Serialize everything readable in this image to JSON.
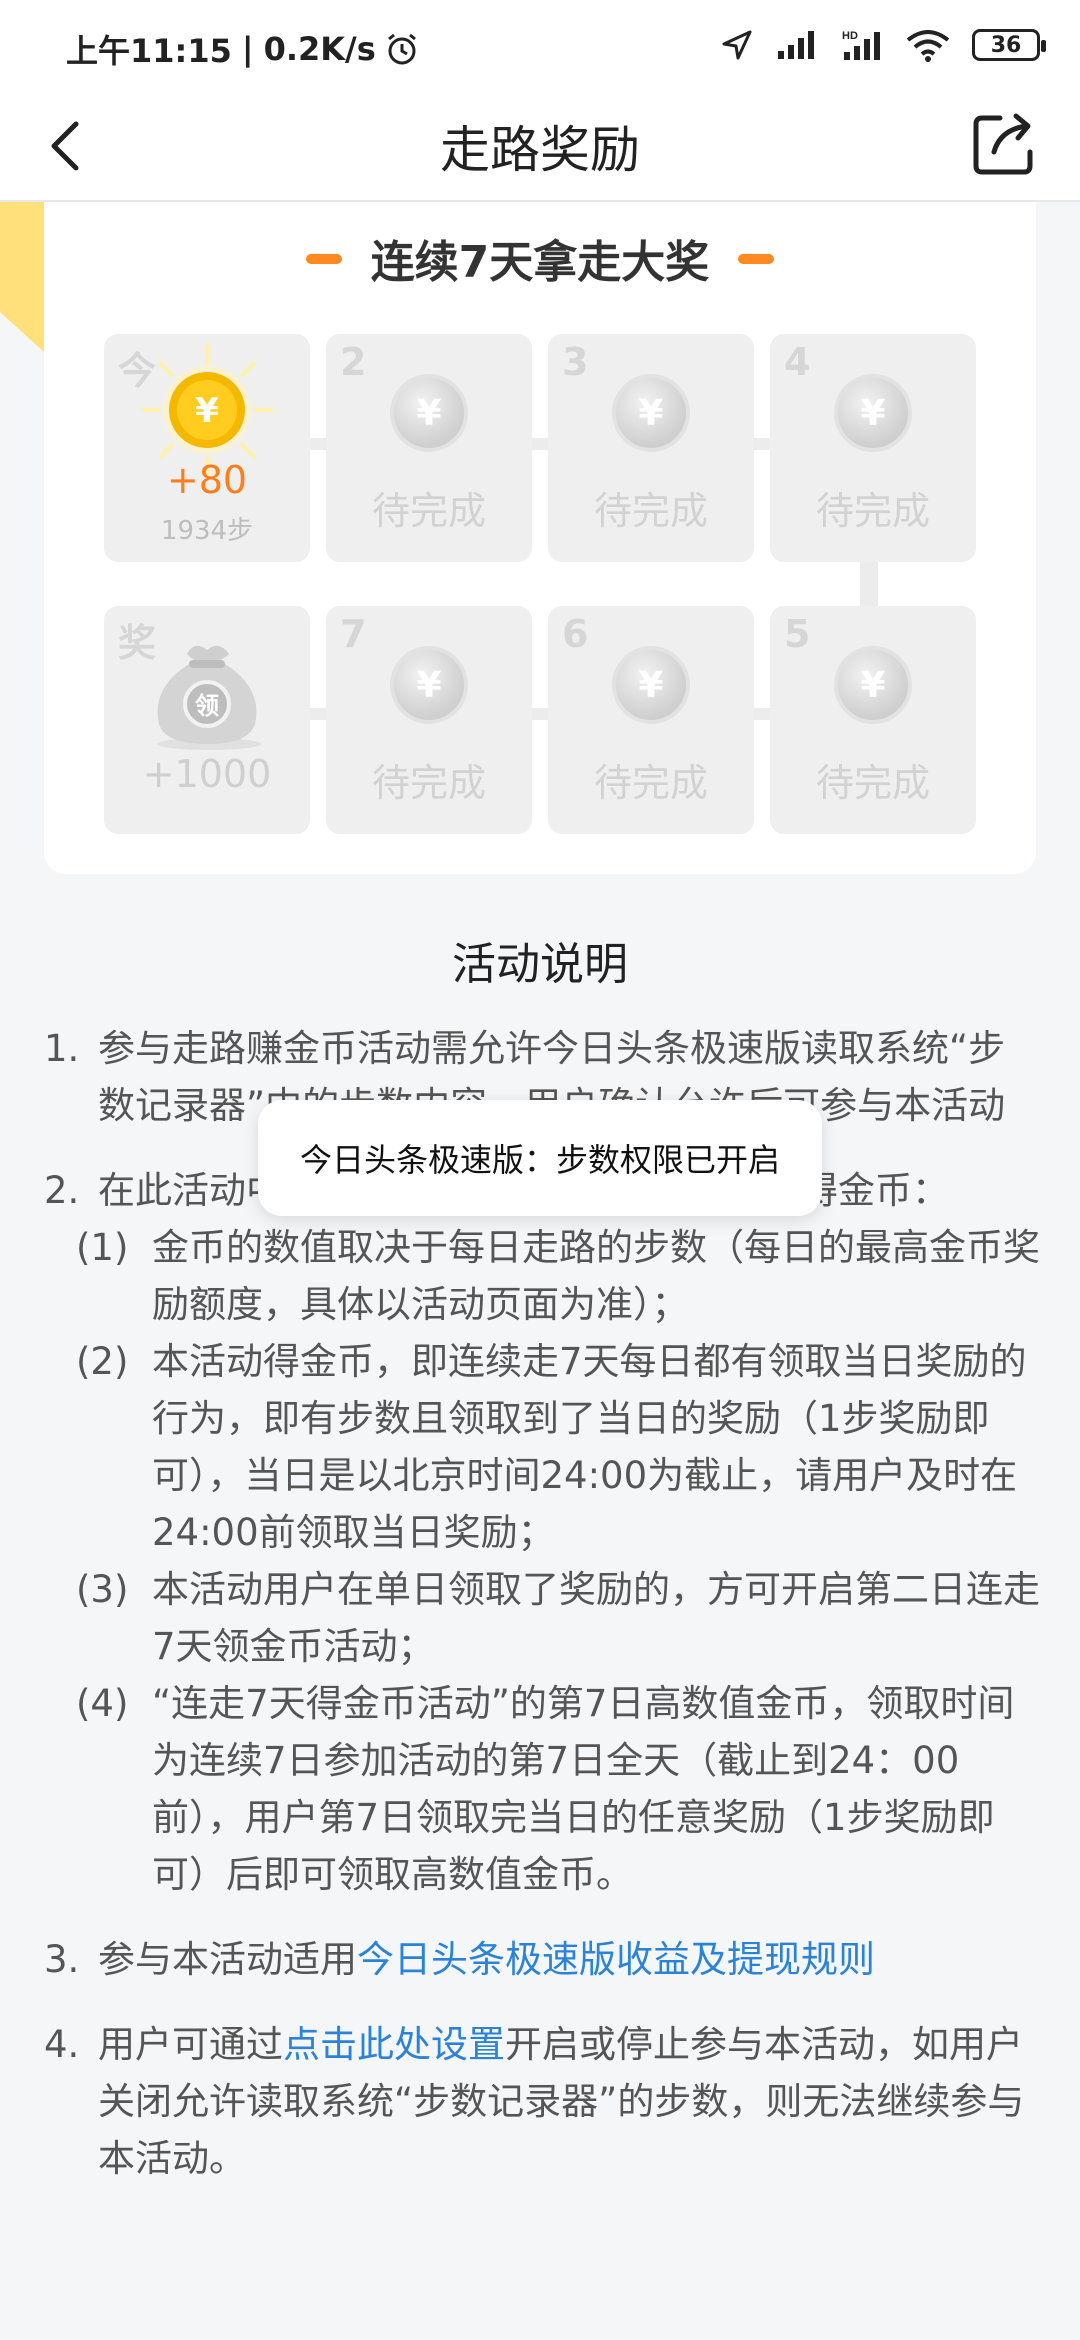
{
  "status_bar": {
    "time": "上午11:15",
    "speed": "0.2K/s",
    "battery": "36"
  },
  "nav": {
    "title": "走路奖励"
  },
  "streak": {
    "title": "连续7天拿走大奖",
    "today": {
      "label": "今",
      "reward": "+80",
      "steps": "1934步"
    },
    "days": [
      {
        "label": "2",
        "status": "待完成"
      },
      {
        "label": "3",
        "status": "待完成"
      },
      {
        "label": "4",
        "status": "待完成"
      },
      {
        "label": "5",
        "status": "待完成"
      },
      {
        "label": "6",
        "status": "待完成"
      },
      {
        "label": "7",
        "status": "待完成"
      }
    ],
    "prize": {
      "label": "奖",
      "bag_text": "领",
      "reward": "+1000"
    },
    "coin_symbol": "¥"
  },
  "description": {
    "title": "活动说明",
    "rules": [
      {
        "index": "1.",
        "text": "参与走路赚金币活动需允许今日头条极速版读取系统“步数记录器”中的步数内容，用户确认允许后可参与本活动"
      },
      {
        "index": "2.",
        "text": "在此活动中，用户可通过每日走路的步数获得金币："
      },
      {
        "index": "3.",
        "text_before": "参与本活动适用",
        "link": "今日头条极速版收益及提现规则"
      },
      {
        "index": "4.",
        "text_before": "用户可通过",
        "link": "点击此处设置",
        "text_after": "开启或停止参与本活动，如用户关闭允许读取系统“步数记录器”的步数，则无法继续参与本活动。"
      }
    ],
    "subrules": [
      {
        "index": "(1)",
        "text": "金币的数值取决于每日走路的步数（每日的最高金币奖励额度，具体以活动页面为准）；"
      },
      {
        "index": "(2)",
        "text": "本活动得金币，即连续走7天每日都有领取当日奖励的行为，即有步数且领取到了当日的奖励（1步奖励即可），当日是以北京时间24:00为截止，请用户及时在24:00前领取当日奖励；"
      },
      {
        "index": "(3)",
        "text": "本活动用户在单日领取了奖励的，方可开启第二日连走7天领金币活动；"
      },
      {
        "index": "(4)",
        "text": "“连走7天得金币活动”的第7日高数值金币，领取时间为连续7日参加活动的第7日全天（截止到24：00前），用户第7日领取完当日的任意奖励（1步奖励即可）后即可领取高数值金币。"
      }
    ]
  },
  "toast": {
    "text": "今日头条极速版：步数权限已开启"
  },
  "colors": {
    "accent": "#ff8a1f",
    "link": "#2a83d8",
    "coin_gold": "#f5b800"
  }
}
